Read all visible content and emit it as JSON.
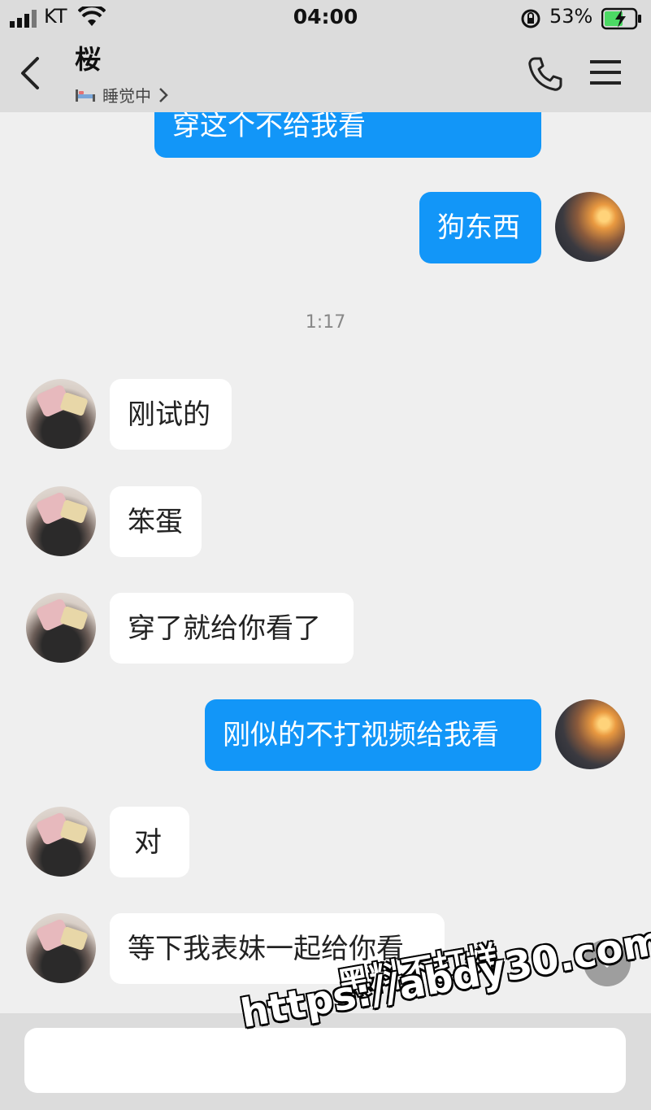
{
  "status": {
    "carrier": "KT",
    "time": "04:00",
    "battery": "53%"
  },
  "header": {
    "contact_name": "桜",
    "presence": "睡觉中"
  },
  "messages": [
    {
      "side": "out",
      "text": "穿这个不给我看"
    },
    {
      "side": "out",
      "text": "狗东西"
    },
    {
      "side": "in",
      "text": "刚试的"
    },
    {
      "side": "in",
      "text": "笨蛋"
    },
    {
      "side": "in",
      "text": "穿了就给你看了"
    },
    {
      "side": "out",
      "text": "刚似的不打视频给我看"
    },
    {
      "side": "in",
      "text": "对"
    },
    {
      "side": "in",
      "text": "等下我表妹一起给你看"
    }
  ],
  "timestamp": "1:17",
  "input": {
    "placeholder": ""
  },
  "watermark": {
    "line1": "黑料不打烊",
    "line2": "https://abdy30.com"
  },
  "colors": {
    "outgoing_bubble": "#1296f8",
    "incoming_bubble": "#ffffff",
    "header_bg": "#dcdcdc",
    "chat_bg": "#efefef"
  }
}
